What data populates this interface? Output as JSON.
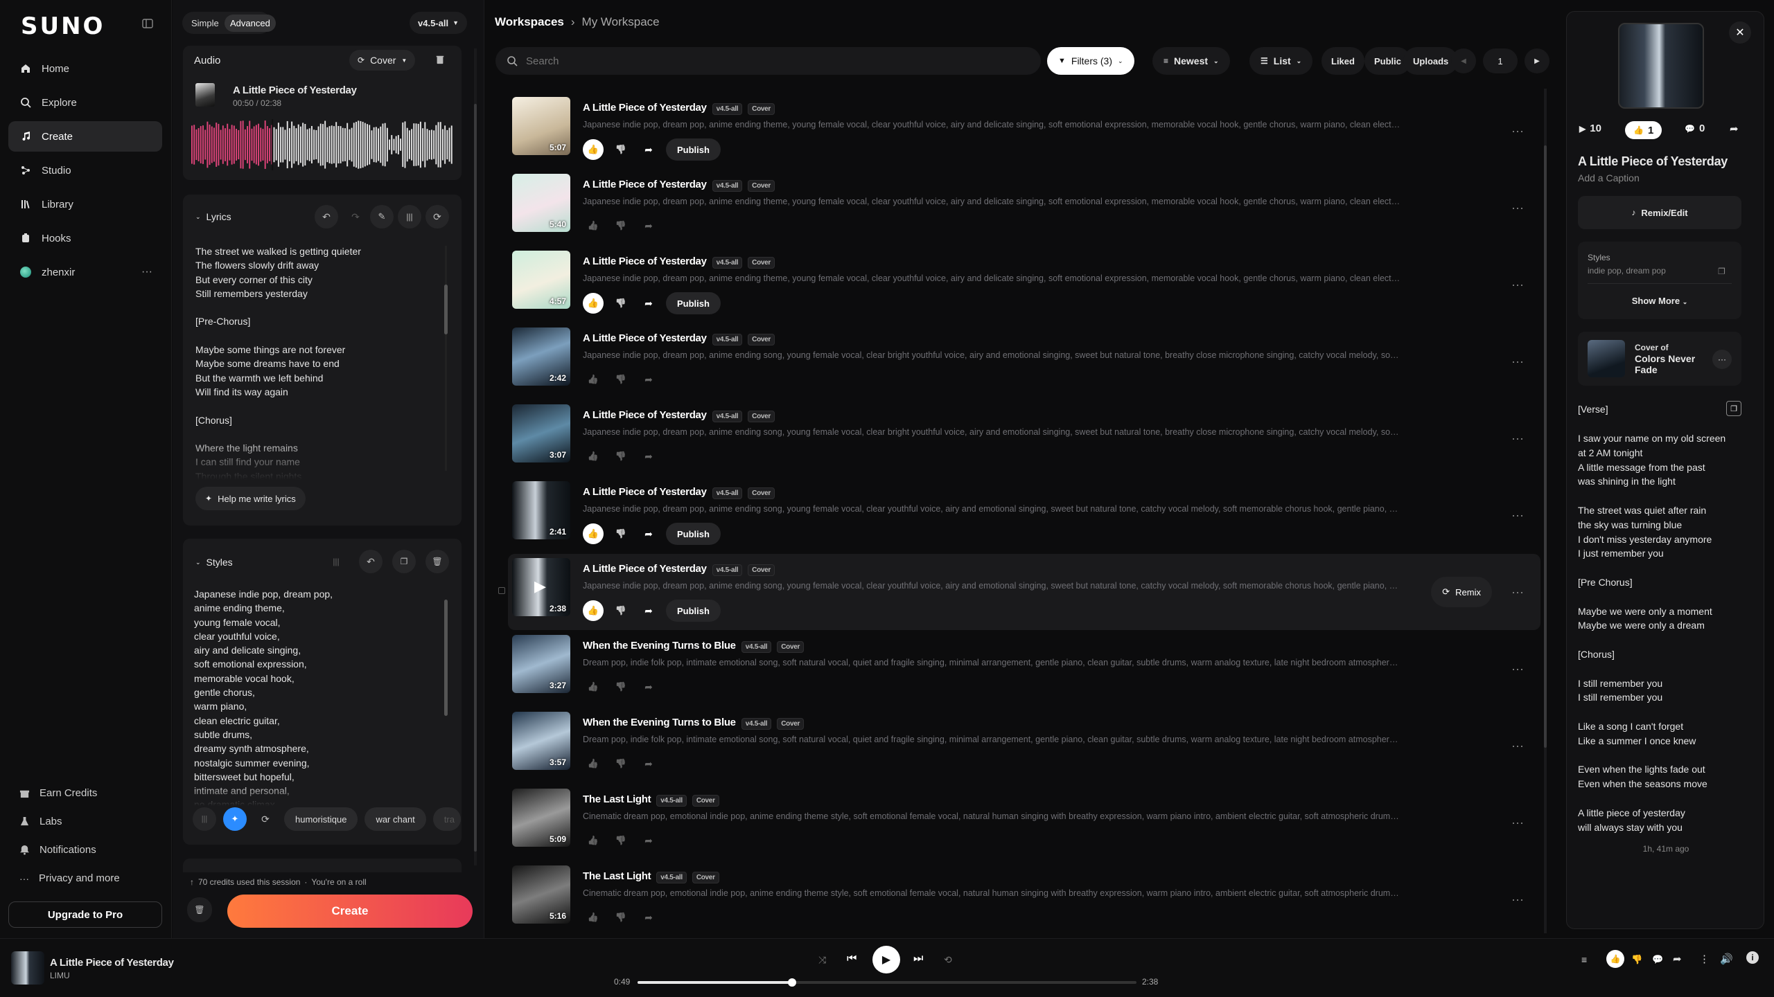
{
  "app": {
    "logo": "SUNO"
  },
  "sidebar": {
    "items": [
      {
        "label": "Home",
        "icon": "home-icon"
      },
      {
        "label": "Explore",
        "icon": "search-icon"
      },
      {
        "label": "Create",
        "icon": "music-note-icon"
      },
      {
        "label": "Studio",
        "icon": "studio-icon"
      },
      {
        "label": "Library",
        "icon": "library-icon"
      },
      {
        "label": "Hooks",
        "icon": "hooks-icon"
      },
      {
        "label": "zhenxir",
        "icon": "avatar"
      }
    ],
    "bottom": [
      {
        "label": "Earn Credits",
        "icon": "gift-icon"
      },
      {
        "label": "Labs",
        "icon": "flask-icon"
      },
      {
        "label": "Notifications",
        "icon": "bell-icon"
      },
      {
        "label": "Privacy and more",
        "icon": "dots-icon"
      }
    ],
    "upgrade_label": "Upgrade to Pro"
  },
  "create": {
    "mode_simple": "Simple",
    "mode_advanced": "Advanced",
    "model": "v4.5-all",
    "audio": {
      "header": "Audio",
      "mode": "Cover",
      "title": "A Little Piece of Yesterday",
      "time": "00:50 / 02:38"
    },
    "lyrics": {
      "header": "Lyrics",
      "text": "The street we walked is getting quieter\nThe flowers slowly drift away\nBut every corner of this city\nStill remembers yesterday\n\n[Pre-Chorus]\n\nMaybe some things are not forever\nMaybe some dreams have to end\nBut the warmth we left behind\nWill find its way again\n\n[Chorus]\n\nWhere the light remains\nI can still find your name\nThrough the silent nights",
      "help_label": "Help me write lyrics"
    },
    "styles": {
      "header": "Styles",
      "text": "Japanese indie pop, dream pop,\nanime ending theme,\nyoung female vocal,\nclear youthful voice,\nairy and delicate singing,\nsoft emotional expression,\nmemorable vocal hook,\ngentle chorus,\nwarm piano,\nclean electric guitar,\nsubtle drums,\ndreamy synth atmosphere,\nnostalgic summer evening,\nbittersweet but hopeful,\nintimate and personal,\nno dramatic climax",
      "chips": [
        "humoristique",
        "war chant",
        "tra"
      ]
    },
    "credits_note": "70 credits used this session",
    "credits_tail": "You're on a roll",
    "create_label": "Create"
  },
  "main": {
    "breadcrumb": [
      "Workspaces",
      "My Workspace"
    ],
    "search_placeholder": "Search",
    "filters_label": "Filters (3)",
    "sort_label": "Newest",
    "view_label": "List",
    "toggles": [
      "Liked",
      "Public",
      "Uploads"
    ],
    "page": "1",
    "publish_label": "Publish",
    "remix_label": "Remix",
    "songs": [
      {
        "title": "A Little Piece of Yesterday",
        "model": "v4.5-all",
        "tag": "Cover",
        "duration": "5:07",
        "liked": true,
        "publish": true,
        "desc": "Japanese indie pop, dream pop, anime ending theme, young female vocal, clear youthful voice, airy and delicate singing, soft emotional expression, memorable vocal hook, gentle chorus, warm piano, clean electric guitar, subtle drums,..."
      },
      {
        "title": "A Little Piece of Yesterday",
        "model": "v4.5-all",
        "tag": "Cover",
        "duration": "5:40",
        "liked": false,
        "publish": false,
        "desc": "Japanese indie pop, dream pop, anime ending theme, young female vocal, clear youthful voice, airy and delicate singing, soft emotional expression, memorable vocal hook, gentle chorus, warm piano, clean electric guitar, subtle drums,..."
      },
      {
        "title": "A Little Piece of Yesterday",
        "model": "v4.5-all",
        "tag": "Cover",
        "duration": "4:57",
        "liked": true,
        "publish": true,
        "desc": "Japanese indie pop, dream pop, anime ending theme, young female vocal, clear youthful voice, airy and delicate singing, soft emotional expression, memorable vocal hook, gentle chorus, warm piano, clean electric guitar, subtle drums,..."
      },
      {
        "title": "A Little Piece of Yesterday",
        "model": "v4.5-all",
        "tag": "Cover",
        "duration": "2:42",
        "liked": false,
        "publish": false,
        "desc": "Japanese indie pop, dream pop, anime ending song, young female vocal, clear bright youthful voice, airy and emotional singing, sweet but natural tone, breathy close microphone singing, catchy vocal melody, soft memorable chorus h..."
      },
      {
        "title": "A Little Piece of Yesterday",
        "model": "v4.5-all",
        "tag": "Cover",
        "duration": "3:07",
        "liked": false,
        "publish": false,
        "desc": "Japanese indie pop, dream pop, anime ending song, young female vocal, clear bright youthful voice, airy and emotional singing, sweet but natural tone, breathy close microphone singing, catchy vocal melody, soft memorable chorus h..."
      },
      {
        "title": "A Little Piece of Yesterday",
        "model": "v4.5-all",
        "tag": "Cover",
        "duration": "2:41",
        "liked": true,
        "publish": true,
        "desc": "Japanese indie pop, dream pop, anime ending song, young female vocal, clear youthful voice, airy and emotional singing, sweet but natural tone, catchy vocal melody, soft memorable chorus hook, gentle piano, clean electric guitar,..."
      },
      {
        "title": "A Little Piece of Yesterday",
        "model": "v4.5-all",
        "tag": "Cover",
        "duration": "2:38",
        "liked": true,
        "publish": true,
        "desc": "Japanese indie pop, dream pop, anime ending song, young female vocal, clear youthful voice, airy and emotional singing, sweet but natural tone, catchy vocal melody, soft memorable chorus hook, gentle piano, clean electric guitar,..."
      },
      {
        "title": "When the Evening Turns to Blue",
        "model": "v4.5-all",
        "tag": "Cover",
        "duration": "3:27",
        "liked": false,
        "publish": false,
        "desc": "Dream pop, indie folk pop, intimate emotional song, soft natural vocal, quiet and fragile singing, minimal arrangement, gentle piano, clean guitar, subtle drums, warm analog texture, late night bedroom atmosphere, nostalgic and realisti..."
      },
      {
        "title": "When the Evening Turns to Blue",
        "model": "v4.5-all",
        "tag": "Cover",
        "duration": "3:57",
        "liked": false,
        "publish": false,
        "desc": "Dream pop, indie folk pop, intimate emotional song, soft natural vocal, quiet and fragile singing, minimal arrangement, gentle piano, clean guitar, subtle drums, warm analog texture, late night bedroom atmosphere, nostalgic and realisti..."
      },
      {
        "title": "The Last Light",
        "model": "v4.5-all",
        "tag": "Cover",
        "duration": "5:09",
        "liked": false,
        "publish": false,
        "desc": "Cinematic dream pop, emotional indie pop, anime ending theme style, soft emotional female vocal, natural human singing with breathy expression, warm piano intro, ambient electric guitar, soft atmospheric drums, beautiful layered sy..."
      },
      {
        "title": "The Last Light",
        "model": "v4.5-all",
        "tag": "Cover",
        "duration": "5:16",
        "liked": false,
        "publish": false,
        "desc": "Cinematic dream pop, emotional indie pop, anime ending theme style, soft emotional female vocal, natural human singing with breathy expression, warm piano intro, ambient electric guitar, soft atmospheric drums, beautiful layered sy..."
      }
    ]
  },
  "detail": {
    "plays": "10",
    "likes": "1",
    "comments": "0",
    "title": "A Little Piece of Yesterday",
    "caption": "Add a Caption",
    "remix_label": "Remix/Edit",
    "styles_header": "Styles",
    "styles_value": "indie pop, dream pop",
    "show_more": "Show More",
    "cover_of_label": "Cover of",
    "cover_of_title": "Colors Never Fade",
    "lyrics": "I saw your name on my old screen\nat 2 AM tonight\nA little message from the past\nwas shining in the light\n\nThe street was quiet after rain\nthe sky was turning blue\nI don't miss yesterday anymore\nI just remember you\n\n[Pre Chorus]\n\nMaybe we were only a moment\nMaybe we were only a dream\n\n[Chorus]\n\nI still remember you\nI still remember you\n\nLike a song I can't forget\nLike a summer I once knew\n\nEven when the lights fade out\nEven when the seasons move\n\nA little piece of yesterday\nwill always stay with you",
    "verse_label": "[Verse]",
    "time_ago": "1h, 41m ago"
  },
  "player": {
    "title": "A Little Piece of Yesterday",
    "artist": "LIMU",
    "elapsed": "0:49",
    "total": "2:38",
    "progress": 0.31
  },
  "colors": {
    "accent": "#e0447a",
    "create_gradient_start": "#ff7a3d",
    "create_gradient_end": "#e83a5a",
    "wand_blue": "#2b8cff"
  }
}
